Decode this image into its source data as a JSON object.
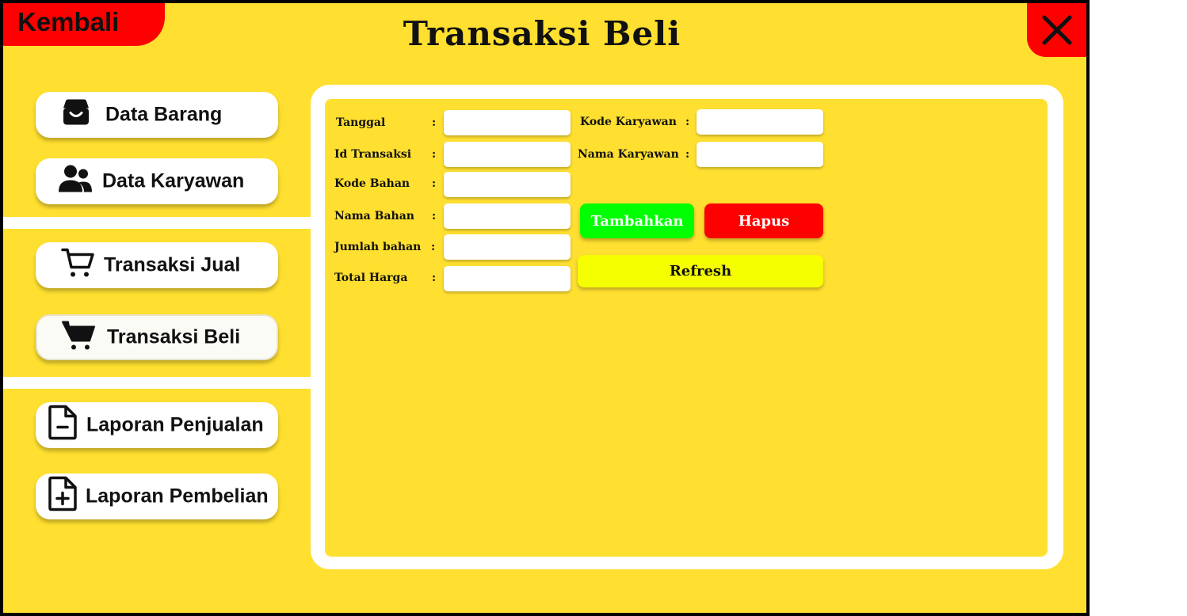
{
  "header": {
    "back_label": "Kembali",
    "title": "Transaksi Beli",
    "close_icon": "close-icon"
  },
  "sidebar": {
    "items": [
      {
        "label": "Data Barang",
        "icon": "box-icon"
      },
      {
        "label": "Data Karyawan",
        "icon": "users-icon"
      },
      {
        "label": "Transaksi Jual",
        "icon": "cart-outline-icon"
      },
      {
        "label": "Transaksi Beli",
        "icon": "cart-filled-icon",
        "active": true
      },
      {
        "label": "Laporan Penjualan",
        "icon": "file-minus-icon"
      },
      {
        "label": "Laporan Pembelian",
        "icon": "file-plus-icon"
      }
    ]
  },
  "form": {
    "colon": ":",
    "tanggal": {
      "label": "Tanggal",
      "value": ""
    },
    "id_transaksi": {
      "label": "Id Transaksi",
      "value": ""
    },
    "kode_bahan": {
      "label": "Kode Bahan",
      "value": ""
    },
    "nama_bahan": {
      "label": "Nama Bahan",
      "value": ""
    },
    "jumlah_bahan": {
      "label": "Jumlah bahan",
      "value": ""
    },
    "total_harga": {
      "label": "Total Harga",
      "value": ""
    },
    "kode_karyawan": {
      "label": "Kode Karyawan",
      "value": ""
    },
    "nama_karyawan": {
      "label": "Nama Karyawan",
      "value": ""
    }
  },
  "actions": {
    "tambahkan": "Tambahkan",
    "hapus": "Hapus",
    "refresh": "Refresh"
  },
  "colors": {
    "background": "#ffdf30",
    "danger": "#ff0000",
    "success": "#00ff00",
    "refresh": "#f5ff00"
  }
}
